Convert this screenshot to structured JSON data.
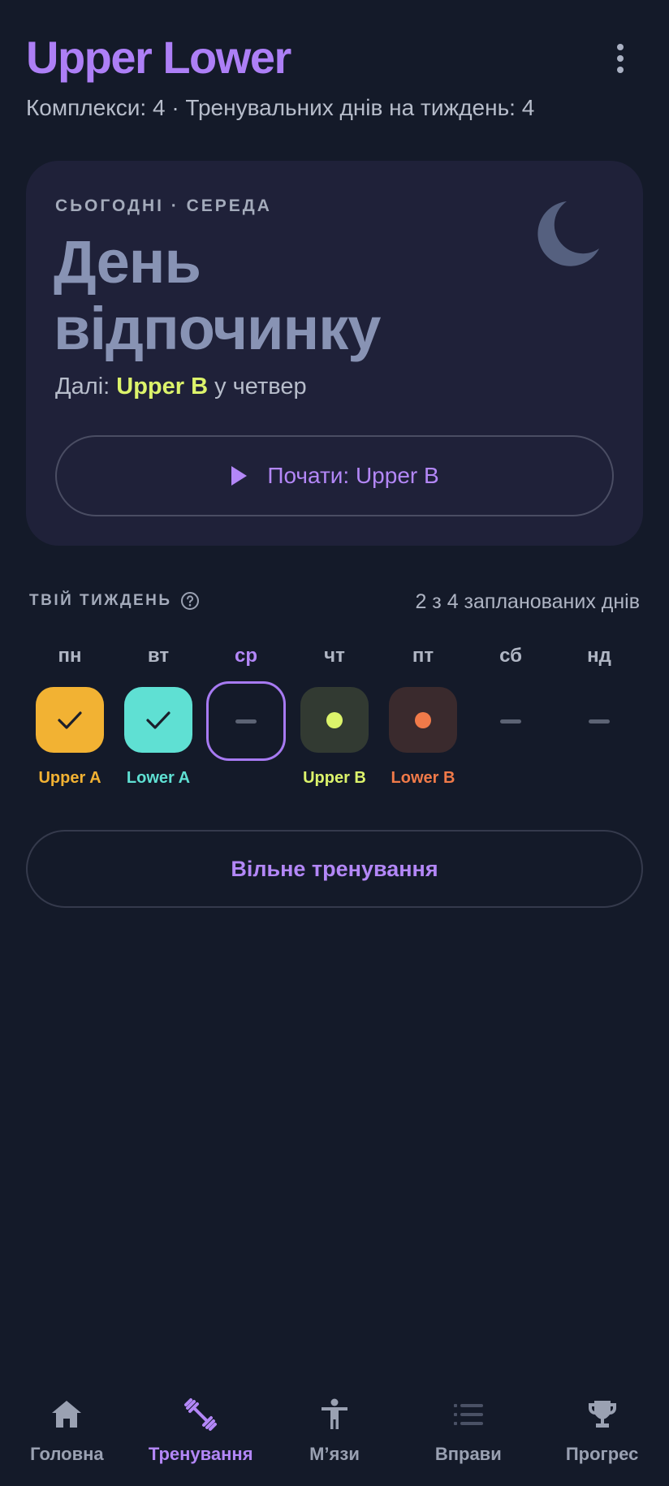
{
  "header": {
    "title": "Upper Lower",
    "subtitle": "Комплекси: 4 · Тренувальних днів на тиждень: 4",
    "more_icon": "more-vert-icon"
  },
  "today": {
    "label": "СЬОГОДНІ · СЕРЕДА",
    "title_line1": "День",
    "title_line2": "відпочинку",
    "next_prefix": "Далі:",
    "next_workout": "Upper B",
    "next_suffix": "у четвер",
    "icon": "moon-icon",
    "start_button": "Почати: Upper B"
  },
  "week": {
    "label": "ТВІЙ ТИЖДЕНЬ",
    "count": "2 з 4 запланованих днів",
    "days": [
      {
        "name": "пн",
        "plan": "Upper A",
        "status": "done",
        "color": "#f2b233",
        "text_color": "#f2b233"
      },
      {
        "name": "вт",
        "plan": "Lower A",
        "status": "done",
        "color": "#5fe0d3",
        "text_color": "#5fe0d3"
      },
      {
        "name": "ср",
        "plan": "",
        "status": "today-rest",
        "color": "#a77af2",
        "text_color": "#b387f7"
      },
      {
        "name": "чт",
        "plan": "Upper B",
        "status": "planned",
        "color": "#323a32",
        "dot": "#dcf36b",
        "text_color": "#dcf36b"
      },
      {
        "name": "пт",
        "plan": "Lower B",
        "status": "planned",
        "color": "#3a2a2d",
        "dot": "#f07a49",
        "text_color": "#f07a49"
      },
      {
        "name": "сб",
        "plan": "",
        "status": "rest",
        "color": "",
        "text_color": ""
      },
      {
        "name": "нд",
        "plan": "",
        "status": "rest",
        "color": "",
        "text_color": ""
      }
    ]
  },
  "free_workout_button": "Вільне тренування",
  "nav": {
    "items": [
      {
        "label": "Головна",
        "icon": "home-icon"
      },
      {
        "label": "Тренування",
        "icon": "dumbbell-icon"
      },
      {
        "label": "М’язи",
        "icon": "body-icon"
      },
      {
        "label": "Вправи",
        "icon": "list-icon"
      },
      {
        "label": "Прогрес",
        "icon": "trophy-icon"
      }
    ],
    "active_index": 1
  },
  "colors": {
    "accent": "#ad7ff6",
    "background": "#141a29",
    "card": "#1f2139",
    "highlight": "#dcf36b"
  }
}
